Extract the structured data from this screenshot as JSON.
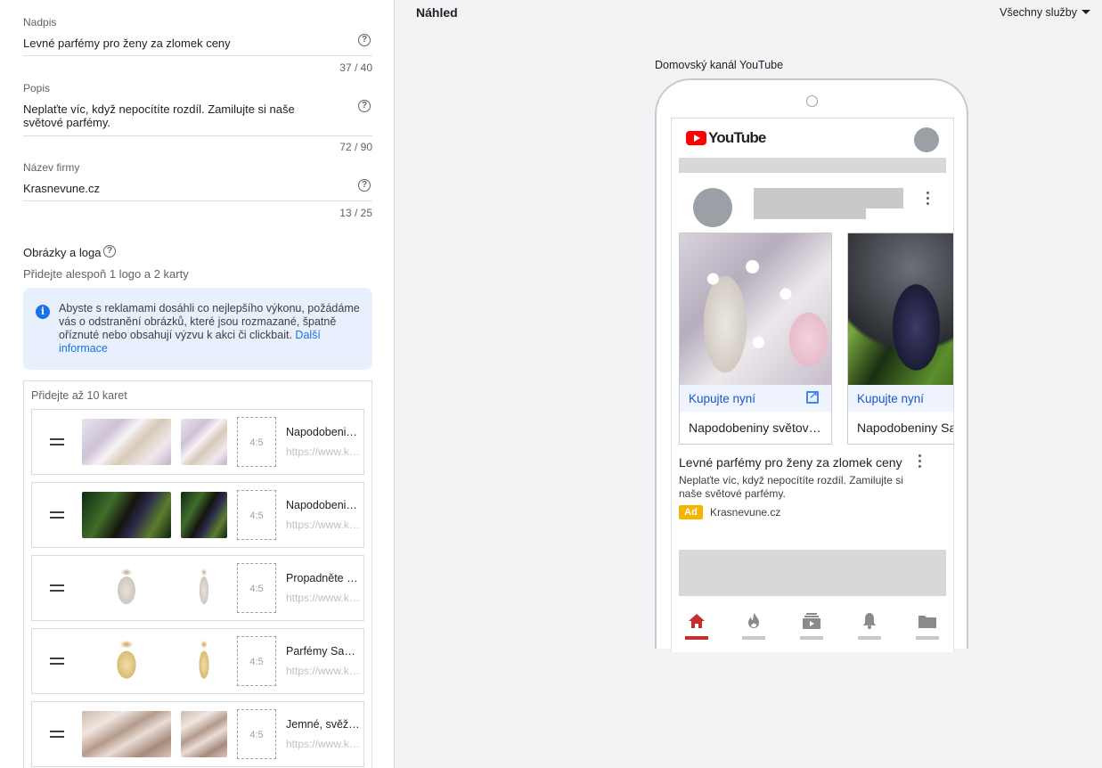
{
  "form": {
    "headline": {
      "label": "Nadpis",
      "value": "Levné parfémy pro ženy za zlomek ceny",
      "count": "37 / 40"
    },
    "description": {
      "label": "Popis",
      "value": "Neplaťte víc, když nepocítíte rozdíl. Zamilujte si naše světové parfémy.",
      "count": "72 / 90"
    },
    "business": {
      "label": "Název firmy",
      "value": "Krasnevune.cz",
      "count": "13 / 25"
    },
    "help_glyph": "?"
  },
  "images": {
    "title": "Obrázky a loga",
    "subtitle": "Přidejte alespoň 1 logo a 2 karty",
    "info_text": "Abyste s reklamami dosáhli co nejlepšího výkonu, požádáme vás o odstranění obrázků, které jsou rozmazané, špatně oříznuté nebo obsahují výzvu k akci či clickbait.",
    "info_link": "Další informace",
    "info_glyph": "i"
  },
  "cards": {
    "hint": "Přidejte až 10 karet",
    "ratio_label": "4:5",
    "items": [
      {
        "name": "Napodobeniny světových parfémů",
        "url": "https://www.krasnevune.cz",
        "image": "lace-flowers-perfume"
      },
      {
        "name": "Napodobeniny Saphir",
        "url": "https://www.krasnevune.cz",
        "image": "palm-perfume-bottle"
      },
      {
        "name": "Propadněte kouzlu",
        "url": "https://www.krasnevune.cz",
        "image": "clear-perfume-bottle"
      },
      {
        "name": "Parfémy Saphir",
        "url": "https://www.krasnevune.cz",
        "image": "gold-perfume-bottle"
      },
      {
        "name": "Jemné, svěží vůně",
        "url": "https://www.krasnevune.cz",
        "image": "fur-perfume-bottle"
      }
    ]
  },
  "preview": {
    "title": "Náhled",
    "services": "Všechny služby",
    "channel": "Domovský kanál YouTube",
    "logo_text": "YouTube",
    "cards": [
      {
        "cta": "Kupujte nyní",
        "name": "Napodobeniny světových parfémů"
      },
      {
        "cta": "Kupujte nyní",
        "name": "Napodobeniny Saphir"
      }
    ],
    "headline": "Levné parfémy pro ženy za zlomek ceny",
    "description": "Neplaťte víc, když nepocítíte rozdíl. Zamilujte si naše světové parfémy.",
    "ad_badge": "Ad",
    "domain": "Krasnevune.cz",
    "nav_icons": [
      "home-icon",
      "trending-icon",
      "subscriptions-icon",
      "notifications-icon",
      "library-icon"
    ]
  },
  "colors": {
    "accent_blue": "#1a73e8",
    "youtube_red": "#ff0000",
    "ad_yellow": "#f4b400",
    "nav_active": "#c4302b"
  }
}
